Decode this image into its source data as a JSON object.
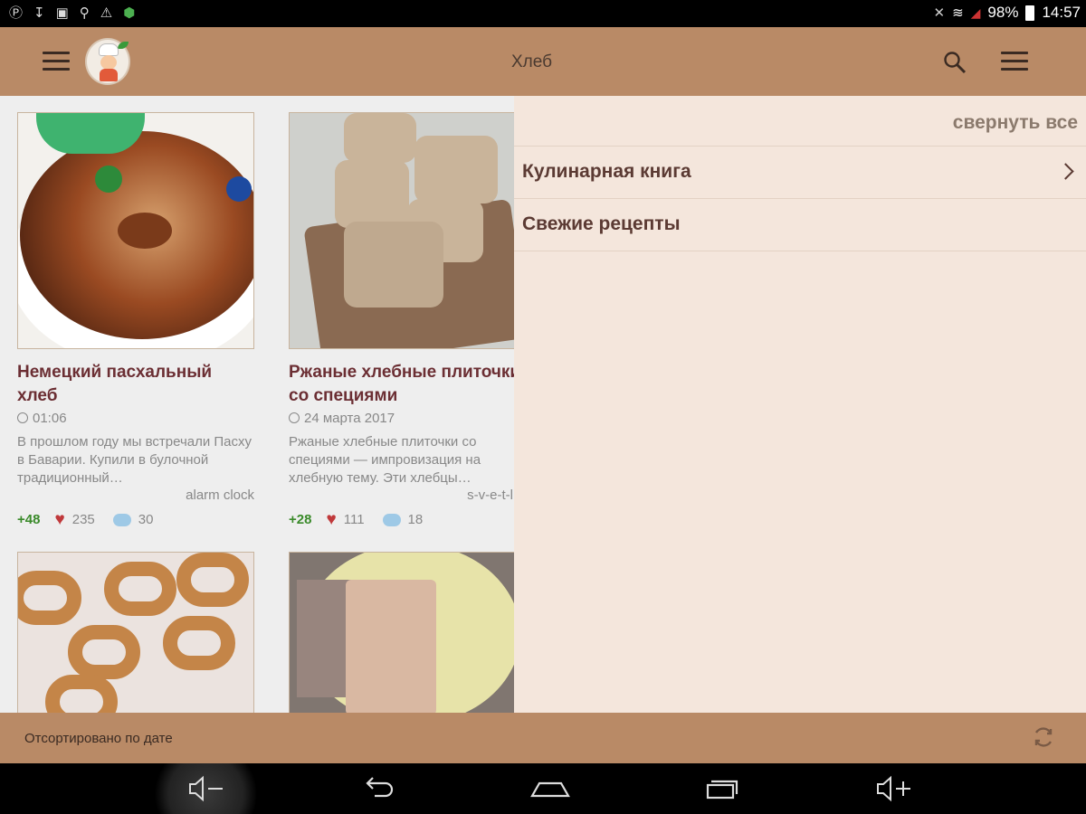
{
  "status_bar": {
    "battery": "98%",
    "time": "14:57"
  },
  "app_bar": {
    "title": "Хлеб"
  },
  "recipes": [
    {
      "title": "Немецкий пасхальный хлеб",
      "date": "01:06",
      "description": "В прошлом году мы встречали Пасху в Баварии. Купили в булочной традиционный…",
      "author": "alarm clock",
      "plus": "+48",
      "likes": "235",
      "comments": "30"
    },
    {
      "title": "Ржаные хлебные плиточки со специями",
      "date": "24 марта 2017",
      "description": "Ржаные хлебные плиточки со специями — импровизация на хлебную тему. Эти хлебцы…",
      "author": "s-v-e-t-l",
      "plus": "+28",
      "likes": "111",
      "comments": "18"
    }
  ],
  "drawer": {
    "collapse_all": "свернуть все",
    "items": [
      {
        "label": "Кулинарная книга",
        "has_chevron": true
      },
      {
        "label": "Свежие рецепты",
        "has_chevron": false
      }
    ]
  },
  "bottom_bar": {
    "sort_label": "Отсортировано по дате"
  },
  "icons": {
    "accent_bar": "#b98a66",
    "drawer_bg": "#f4e6dc",
    "title_color": "#6b2e33"
  }
}
